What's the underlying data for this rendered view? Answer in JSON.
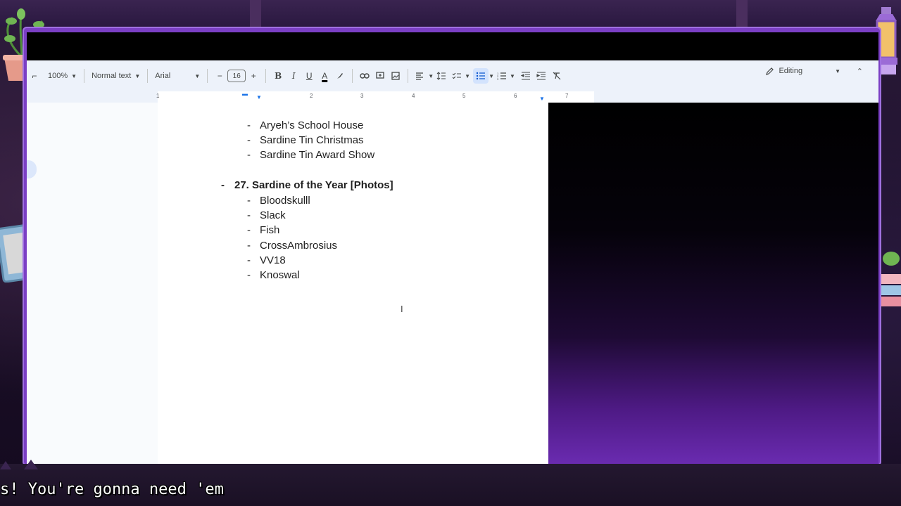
{
  "toolbar": {
    "zoom": "100%",
    "style": "Normal text",
    "font": "Arial",
    "font_size": "16",
    "minus": "−",
    "plus": "+",
    "bold": "B",
    "italic": "I",
    "underline": "U",
    "text_color": "A",
    "mode": "Editing"
  },
  "ruler": {
    "numbers": [
      "1",
      "1",
      "2",
      "3",
      "4",
      "5",
      "6",
      "7"
    ]
  },
  "document": {
    "lines_top": [
      "Aryeh’s School House",
      "Sardine Tin Christmas",
      "Sardine Tin Award Show"
    ],
    "section_heading": "27. Sardine of the Year [Photos]",
    "sub_items": [
      "Bloodskulll",
      "Slack",
      "Fish",
      "CrossAmbrosius",
      "VV18",
      "Knoswal"
    ],
    "dash": "-"
  },
  "stream_overlay": {
    "chat_text": "s! You're gonna need 'em"
  },
  "colors": {
    "frame_purple": "#7b3fc4",
    "toolbar_bg": "#edf2fa",
    "active_blue": "#d3e3fd"
  },
  "icons": [
    "pencil-icon",
    "link-icon",
    "comment-icon",
    "image-icon",
    "align-icon",
    "line-spacing-icon",
    "checklist-icon",
    "bulleted-list-icon",
    "numbered-list-icon",
    "indent-decrease-icon",
    "indent-increase-icon",
    "clear-format-icon",
    "highlighter-icon",
    "chevron-up-icon"
  ]
}
